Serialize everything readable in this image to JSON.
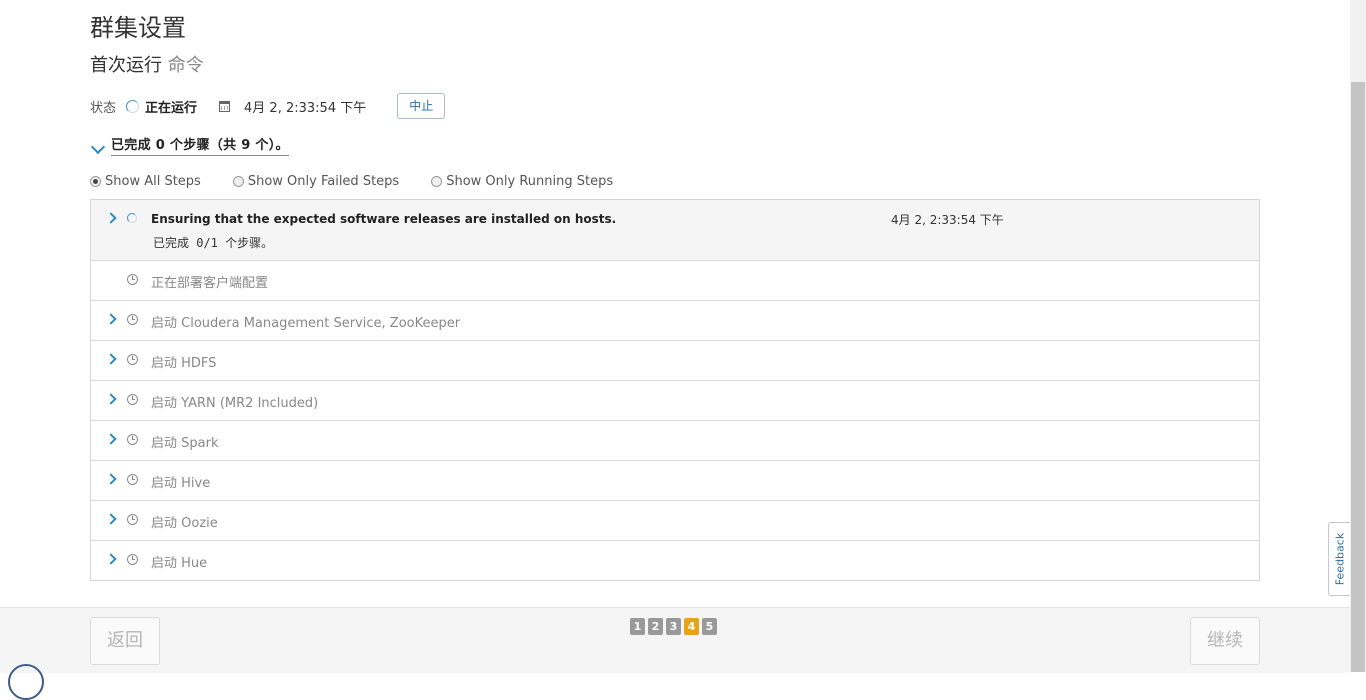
{
  "header": {
    "title": "群集设置",
    "subtitle_main": "首次运行",
    "subtitle_muted": "命令"
  },
  "status": {
    "label": "状态",
    "value": "正在运行",
    "time": "4月 2, 2:33:54 下午",
    "abort_label": "中止"
  },
  "progress": {
    "summary": "已完成 0 个步骤（共 9 个）。"
  },
  "filters": [
    {
      "label": "Show All Steps",
      "checked": true
    },
    {
      "label": "Show Only Failed Steps",
      "checked": false
    },
    {
      "label": "Show Only Running Steps",
      "checked": false
    }
  ],
  "steps": [
    {
      "label": "Ensuring that the expected software releases are installed on hosts.",
      "sub": "已完成 0/1 个步骤。",
      "time": "4月 2, 2:33:54 下午",
      "state": "running",
      "expandable": true
    },
    {
      "label": "正在部署客户端配置",
      "state": "pending",
      "expandable": false
    },
    {
      "label": "启动 Cloudera Management Service, ZooKeeper",
      "state": "pending",
      "expandable": true
    },
    {
      "label": "启动 HDFS",
      "state": "pending",
      "expandable": true
    },
    {
      "label": "启动 YARN (MR2 Included)",
      "state": "pending",
      "expandable": true
    },
    {
      "label": "启动 Spark",
      "state": "pending",
      "expandable": true
    },
    {
      "label": "启动 Hive",
      "state": "pending",
      "expandable": true
    },
    {
      "label": "启动 Oozie",
      "state": "pending",
      "expandable": true
    },
    {
      "label": "启动 Hue",
      "state": "pending",
      "expandable": true
    }
  ],
  "footer": {
    "back_label": "返回",
    "next_label": "继续",
    "pages": [
      "1",
      "2",
      "3",
      "4",
      "5"
    ],
    "current_page": "4"
  },
  "feedback": {
    "label": "Feedback"
  },
  "colors": {
    "accent": "#2b8cc4",
    "current_page": "#e8a21a"
  }
}
